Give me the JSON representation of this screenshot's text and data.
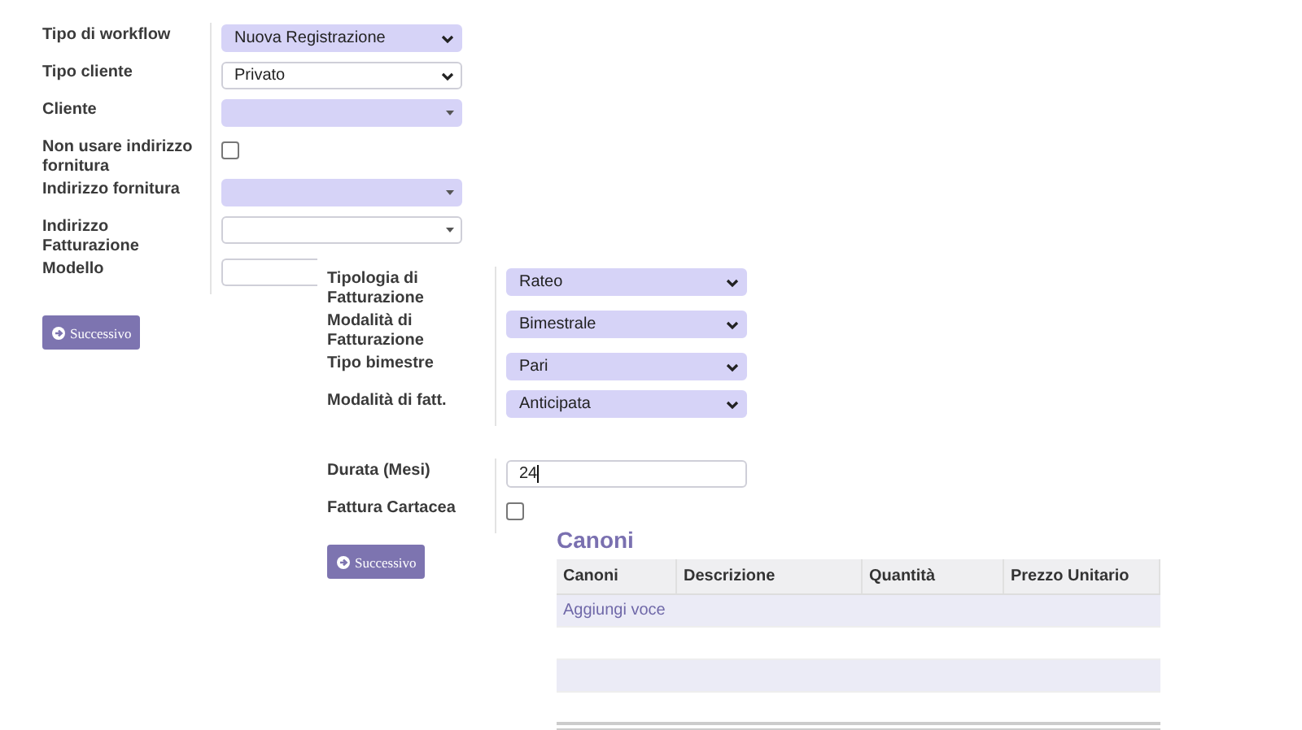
{
  "main_form": {
    "fields": [
      {
        "label": "Tipo di workflow",
        "kind": "select",
        "value": "Nuova Registrazione",
        "required": true
      },
      {
        "label": "Tipo cliente",
        "kind": "select",
        "value": "Privato",
        "required": false
      },
      {
        "label": "Cliente",
        "kind": "lookup",
        "required": true
      },
      {
        "label": "Non usare indirizzo fornitura",
        "kind": "checkbox",
        "checked": false
      },
      {
        "label": "Indirizzo fornitura",
        "kind": "lookup",
        "required": true
      },
      {
        "label": "Indirizzo Fatturazione",
        "kind": "lookup",
        "required": false
      },
      {
        "label": "Modello",
        "kind": "input",
        "required": false
      }
    ],
    "button": "Successivo"
  },
  "billing_form": {
    "sections": [
      {
        "fields": [
          {
            "label": "Tipologia di Fatturazione",
            "kind": "select",
            "value": "Rateo",
            "required": true
          },
          {
            "label": "Modalità di Fatturazione",
            "kind": "select",
            "value": "Bimestrale",
            "required": true
          },
          {
            "label": "Tipo bimestre",
            "kind": "select",
            "value": "Pari",
            "required": true
          },
          {
            "label": "Modalità di fatt.",
            "kind": "select",
            "value": "Anticipata",
            "required": true
          }
        ]
      },
      {
        "fields": [
          {
            "label": "Durata (Mesi)",
            "kind": "input",
            "value": "24",
            "required": false,
            "focused": true
          },
          {
            "label": "Fattura Cartacea",
            "kind": "checkbox",
            "checked": false
          }
        ]
      }
    ],
    "button": "Successivo"
  },
  "canoni": {
    "title": "Canoni",
    "columns": [
      "Canoni",
      "Descrizione",
      "Quantità",
      "Prezzo Unitario"
    ],
    "add_link": "Aggiungi voce"
  }
}
